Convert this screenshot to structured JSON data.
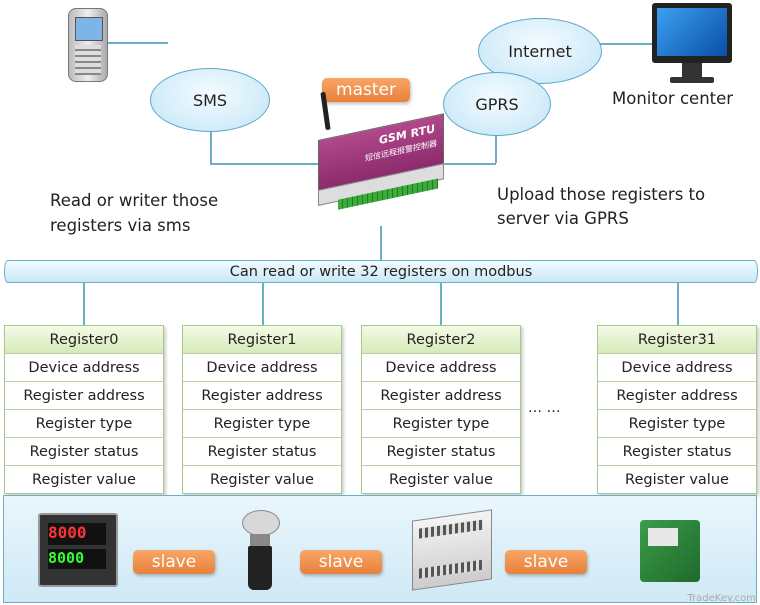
{
  "network": {
    "sms": "SMS",
    "internet": "Internet",
    "gprs": "GPRS",
    "monitor": "Monitor center",
    "master": "master"
  },
  "device": {
    "brand": "GSM RTU",
    "subtitle": "短信远程报警控制器"
  },
  "notes": {
    "left": [
      "Read or writer those",
      "registers via sms"
    ],
    "right": [
      "Upload  those registers to",
      "server via GPRS"
    ]
  },
  "bus": {
    "label": "Can read or write 32 registers on modbus"
  },
  "registers": [
    {
      "title": "Register0",
      "fields": [
        "Device address",
        "Register address",
        "Register type",
        "Register status",
        "Register value"
      ]
    },
    {
      "title": "Register1",
      "fields": [
        "Device address",
        "Register address",
        "Register type",
        "Register status",
        "Register value"
      ]
    },
    {
      "title": "Register2",
      "fields": [
        "Device address",
        "Register address",
        "Register type",
        "Register status",
        "Register value"
      ]
    },
    {
      "title": "Register31",
      "fields": [
        "Device address",
        "Register address",
        "Register type",
        "Register status",
        "Register value"
      ]
    }
  ],
  "ellipsis": "… …",
  "slaves": [
    "slave",
    "slave",
    "slave"
  ],
  "watermark": "TradeKey.com"
}
